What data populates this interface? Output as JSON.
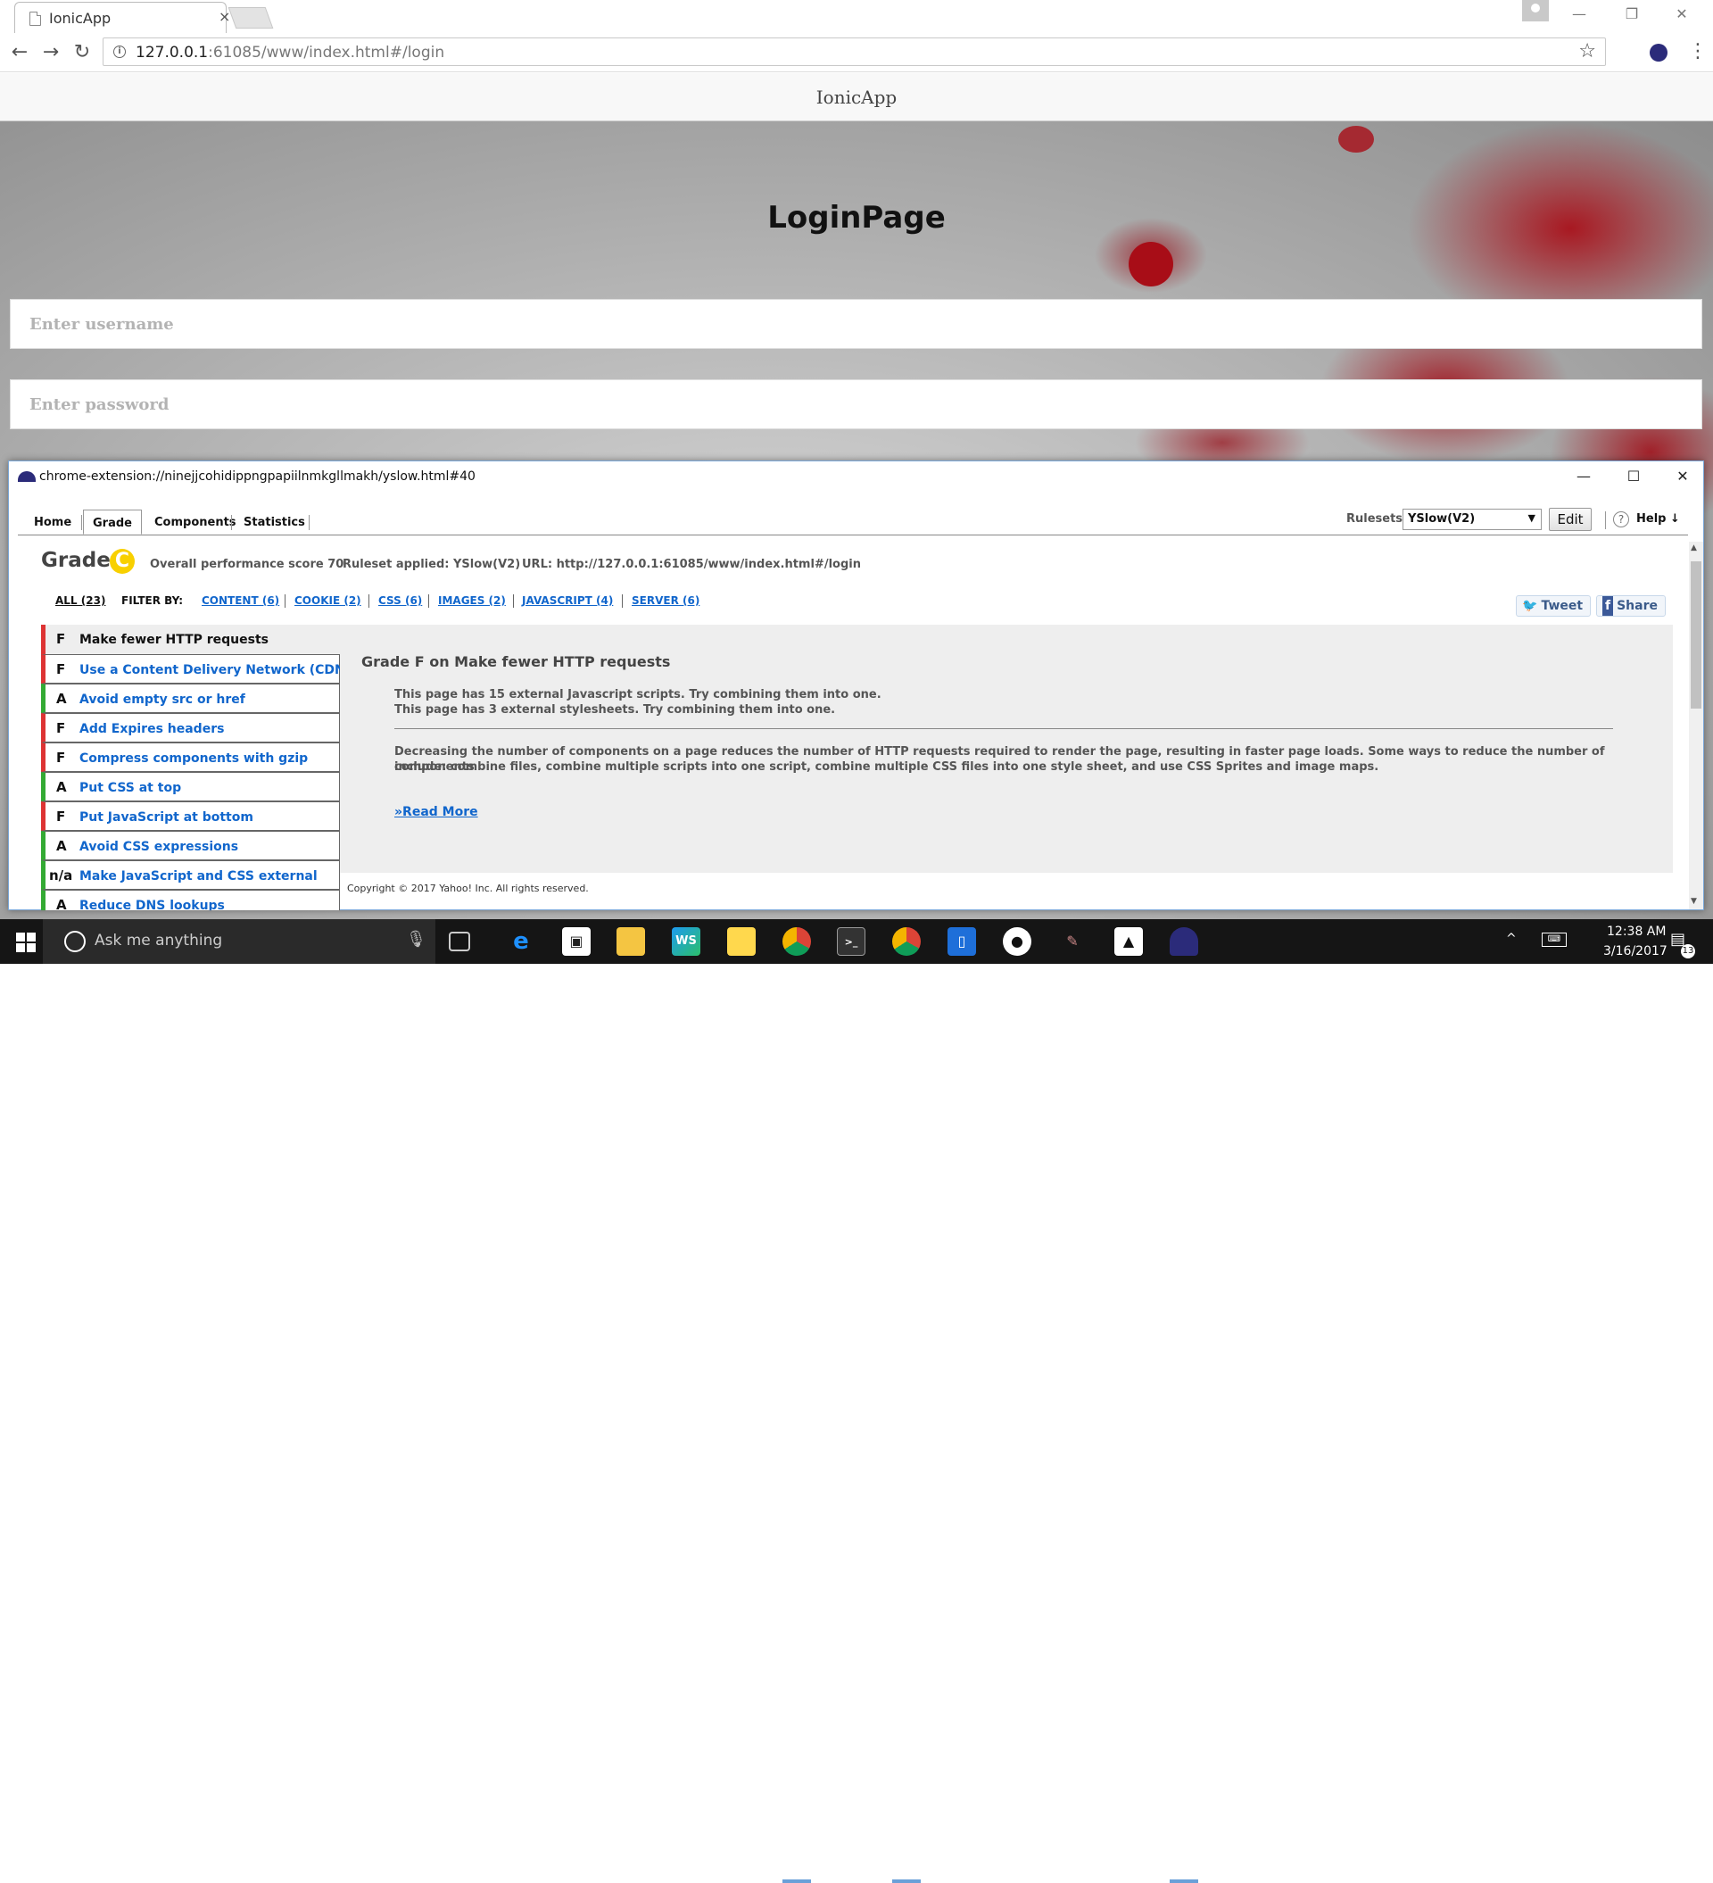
{
  "browser": {
    "tab_title": "IonicApp",
    "tab_close": "×",
    "url_host": "127.0.0.1",
    "url_rest": ":61085/www/index.html#/login",
    "back_glyph": "←",
    "forward_glyph": "→",
    "reload_glyph": "↻",
    "star_glyph": "☆",
    "menu_glyph": "⋮",
    "minimize_glyph": "—",
    "restore_glyph": "❐",
    "close_glyph": "✕"
  },
  "app": {
    "header_title": "IonicApp",
    "login_title": "LoginPage",
    "username_placeholder": "Enter username",
    "password_placeholder": "Enter password"
  },
  "yslow": {
    "window_url": "chrome-extension://ninejjcohidippngpapiilnmkgllmakh/yslow.html#40",
    "tabs": [
      "Home",
      "Grade",
      "Components",
      "Statistics"
    ],
    "selected_tab": "Grade",
    "rulesets_label": "Rulesets",
    "ruleset_value": "YSlow(V2)",
    "edit_label": "Edit",
    "help_label": "Help ↓",
    "help_icon": "?",
    "grade_label": "Grade",
    "grade_value": "C",
    "score_text": "Overall performance score 70",
    "ruleset_text": "Ruleset applied: YSlow(V2)",
    "url_text": "URL: http://127.0.0.1:61085/www/index.html#/login",
    "filter_all": "ALL (23)",
    "filter_by": "FILTER BY:",
    "filters": [
      "CONTENT (6)",
      "COOKIE (2)",
      "CSS (6)",
      "IMAGES (2)",
      "JAVASCRIPT (4)",
      "SERVER (6)"
    ],
    "tweet_label": "Tweet",
    "share_label": "Share",
    "rules": [
      {
        "grade": "F",
        "label": "Make fewer HTTP requests"
      },
      {
        "grade": "F",
        "label": "Use a Content Delivery Network (CDN)"
      },
      {
        "grade": "A",
        "label": "Avoid empty src or href"
      },
      {
        "grade": "F",
        "label": "Add Expires headers"
      },
      {
        "grade": "F",
        "label": "Compress components with gzip"
      },
      {
        "grade": "A",
        "label": "Put CSS at top"
      },
      {
        "grade": "F",
        "label": "Put JavaScript at bottom"
      },
      {
        "grade": "A",
        "label": "Avoid CSS expressions"
      },
      {
        "grade": "n/a",
        "label": "Make JavaScript and CSS external"
      },
      {
        "grade": "A",
        "label": "Reduce DNS lookups"
      }
    ],
    "detail": {
      "title": "Grade F on Make fewer HTTP requests",
      "line1": "This page has 15 external Javascript scripts. Try combining them into one.",
      "line2": "This page has 3 external stylesheets. Try combining them into one.",
      "para1": "Decreasing the number of components on a page reduces the number of HTTP requests required to render the page, resulting in faster page loads. Some ways to reduce the number of components",
      "para2": "include: combine files, combine multiple scripts into one script, combine multiple CSS files into one style sheet, and use CSS Sprites and image maps.",
      "read_more": "»Read More"
    },
    "copyright": "Copyright © 2017 Yahoo! Inc. All rights reserved."
  },
  "taskbar": {
    "search_placeholder": "Ask me anything",
    "time": "12:38 AM",
    "date": "3/16/2017",
    "notification_count": "13"
  }
}
